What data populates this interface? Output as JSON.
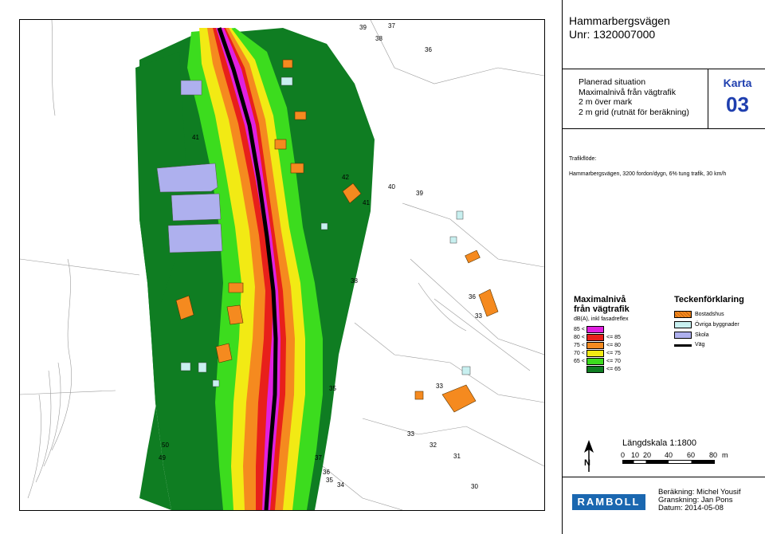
{
  "title": {
    "line1": "Hammarbergsvägen",
    "line2": "Unr: 1320007000"
  },
  "description": {
    "line1": "Planerad situation",
    "line2": "Maximalnivå från vägtrafik",
    "line3": "2 m över mark",
    "line4": "2 m grid (rutnät för beräkning)"
  },
  "karta": {
    "label": "Karta",
    "number": "03",
    "color": "#1f3faf"
  },
  "traffic": {
    "label": "Trafikflöde:",
    "text": "Hammarbergsvägen, 3200 fordon/dygn, 6% tung trafik, 30 km/h"
  },
  "legend_levels": {
    "title1": "Maximalnivå",
    "title2": "från vägtrafik",
    "subtitle": "dB(A), inkl fasadreflex",
    "items": [
      {
        "from": "85 <",
        "to": "",
        "color": "#e020e0"
      },
      {
        "from": "80 <",
        "to": "<= 85",
        "color": "#e8201a"
      },
      {
        "from": "75 <",
        "to": "<= 80",
        "color": "#f58a1f"
      },
      {
        "from": "70 <",
        "to": "<= 75",
        "color": "#f2ea14"
      },
      {
        "from": "65 <",
        "to": "<= 70",
        "color": "#3cdc1e"
      },
      {
        "from": "",
        "to": "<= 65",
        "color": "#0f7d22"
      }
    ]
  },
  "legend_symbols": {
    "title": "Teckenförklaring",
    "items": [
      {
        "label": "Bostadshus",
        "color": "#f58a1f"
      },
      {
        "label": "Övriga byggnader",
        "color": "#c8f0f0"
      },
      {
        "label": "Skola",
        "color": "#aeb0ee"
      },
      {
        "label": "Väg",
        "color": "#000000"
      }
    ]
  },
  "scale": {
    "title": "Längdskala 1:1800",
    "ticks": [
      "0",
      "10",
      "20",
      "40",
      "60",
      "80"
    ],
    "unit": "m",
    "north": "N"
  },
  "logo": {
    "text": "RAMBOLL",
    "color": "#1a67b0"
  },
  "credits": {
    "calc": "Beräkning: Michel Yousif",
    "review": "Granskning: Jan Pons",
    "date": "Datum: 2014-05-08"
  },
  "map_labels": [
    {
      "text": "39",
      "name": "contour-39"
    },
    {
      "text": "37",
      "name": "contour-37"
    },
    {
      "text": "38",
      "name": "contour-38"
    },
    {
      "text": "36",
      "name": "contour-36"
    },
    {
      "text": "40",
      "name": "contour-40"
    },
    {
      "text": "39",
      "name": "contour-39"
    },
    {
      "text": "41",
      "name": "contour-41"
    },
    {
      "text": "38",
      "name": "contour-38"
    },
    {
      "text": "36",
      "name": "contour-36"
    },
    {
      "text": "33",
      "name": "contour-33"
    },
    {
      "text": "33",
      "name": "contour-33"
    },
    {
      "text": "35",
      "name": "contour-35"
    },
    {
      "text": "50",
      "name": "contour-50"
    },
    {
      "text": "49",
      "name": "contour-49"
    },
    {
      "text": "33",
      "name": "contour-33"
    },
    {
      "text": "32",
      "name": "contour-32"
    },
    {
      "text": "31",
      "name": "contour-31"
    },
    {
      "text": "37",
      "name": "contour-37"
    },
    {
      "text": "36",
      "name": "contour-36"
    },
    {
      "text": "35",
      "name": "contour-35"
    },
    {
      "text": "34",
      "name": "contour-34"
    },
    {
      "text": "30",
      "name": "contour-30"
    },
    {
      "text": "42",
      "name": "contour-42"
    },
    {
      "text": "41",
      "name": "contour-41"
    }
  ]
}
